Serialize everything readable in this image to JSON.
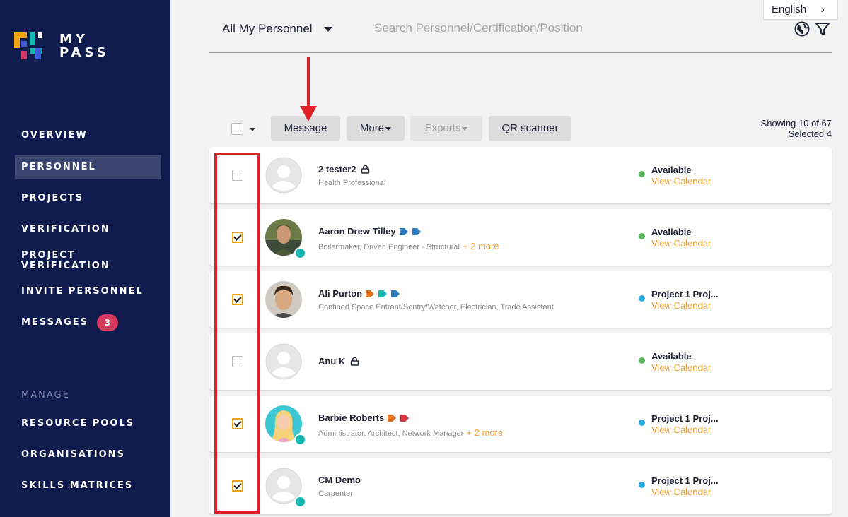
{
  "app": {
    "logo_line1": "MY",
    "logo_line2": "PASS",
    "brand_colors": [
      "#f0a30a",
      "#18b7b0",
      "#d63a5e",
      "#3a5bd9"
    ]
  },
  "sidebar": {
    "items": [
      {
        "label": "OVERVIEW",
        "active": false
      },
      {
        "label": "PERSONNEL",
        "active": true
      },
      {
        "label": "PROJECTS",
        "active": false
      },
      {
        "label": "VERIFICATION",
        "active": false
      },
      {
        "label": "PROJECT VERIFICATION",
        "active": false
      },
      {
        "label": "INVITE PERSONNEL",
        "active": false
      },
      {
        "label": "MESSAGES",
        "active": false,
        "badge": "3"
      }
    ],
    "section_label": "MANAGE",
    "manage_items": [
      {
        "label": "RESOURCE POOLS"
      },
      {
        "label": "ORGANISATIONS"
      },
      {
        "label": "SKILLS MATRICES"
      }
    ]
  },
  "header": {
    "filter_value": "All My Personnel",
    "search_placeholder": "Search Personnel/Certification/Position",
    "language": "English",
    "icons": [
      "globe-icon",
      "filter-icon"
    ]
  },
  "toolbar": {
    "message_label": "Message",
    "more_label": "More",
    "exports_label": "Exports",
    "qr_label": "QR scanner",
    "showing_text": "Showing 10 of 67",
    "selected_text": "Selected 4"
  },
  "personnel": [
    {
      "name": "2 tester2",
      "roles": "Health Professional",
      "more": "",
      "status": "Available",
      "status_color": "#5cb85c",
      "calendar": "View Calendar",
      "checked": false,
      "locked": true,
      "verified": false,
      "tags": [],
      "avatar": "placeholder"
    },
    {
      "name": "Aaron Drew Tilley",
      "roles": "Boilermaker, Driver, Engineer - Structural",
      "more": "+ 2 more",
      "status": "Available",
      "status_color": "#5cb85c",
      "calendar": "View Calendar",
      "checked": true,
      "locked": false,
      "verified": true,
      "tags": [
        "#2d7ac0",
        "#2d7ac0"
      ],
      "avatar": "photo"
    },
    {
      "name": "Ali Purton",
      "roles": "Confined Space Entrant/Sentry/Watcher, Electrician, Trade Assistant",
      "more": "",
      "status": "Project 1 Proj...",
      "status_color": "#2aa9e0",
      "calendar": "View Calendar",
      "checked": true,
      "locked": false,
      "verified": false,
      "tags": [
        "#e0731f",
        "#18b7b0",
        "#2d7ac0"
      ],
      "avatar": "photo"
    },
    {
      "name": "Anu K",
      "roles": "",
      "more": "",
      "status": "Available",
      "status_color": "#5cb85c",
      "calendar": "View Calendar",
      "checked": false,
      "locked": true,
      "verified": false,
      "tags": [],
      "avatar": "placeholder"
    },
    {
      "name": "Barbie Roberts",
      "roles": "Administrator, Architect, Network Manager",
      "more": "+ 2 more",
      "status": "Project 1 Proj...",
      "status_color": "#2aa9e0",
      "calendar": "View Calendar",
      "checked": true,
      "locked": false,
      "verified": true,
      "tags": [
        "#e0731f",
        "#d9363e"
      ],
      "avatar": "photo-cartoon"
    },
    {
      "name": "CM Demo",
      "roles": "Carpenter",
      "more": "",
      "status": "Project 1 Proj...",
      "status_color": "#2aa9e0",
      "calendar": "View Calendar",
      "checked": true,
      "locked": false,
      "verified": true,
      "tags": [],
      "avatar": "placeholder"
    }
  ]
}
